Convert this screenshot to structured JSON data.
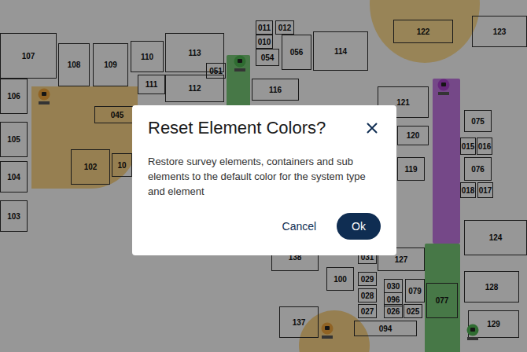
{
  "map": {
    "rooms": [
      {
        "label": "107"
      },
      {
        "label": "108"
      },
      {
        "label": "109"
      },
      {
        "label": "110"
      },
      {
        "label": "113"
      },
      {
        "label": "011"
      },
      {
        "label": "012"
      },
      {
        "label": "010"
      },
      {
        "label": "054"
      },
      {
        "label": "056"
      },
      {
        "label": "114"
      },
      {
        "label": "122"
      },
      {
        "label": "123"
      },
      {
        "label": "106"
      },
      {
        "label": "051"
      },
      {
        "label": "111"
      },
      {
        "label": "112"
      },
      {
        "label": "116"
      },
      {
        "label": "121"
      },
      {
        "label": "045"
      },
      {
        "label": "075"
      },
      {
        "label": "015"
      },
      {
        "label": "016"
      },
      {
        "label": "105"
      },
      {
        "label": "120"
      },
      {
        "label": "076"
      },
      {
        "label": "104"
      },
      {
        "label": "102"
      },
      {
        "label": "10"
      },
      {
        "label": "119"
      },
      {
        "label": "018"
      },
      {
        "label": "017"
      },
      {
        "label": "124"
      },
      {
        "label": "103"
      },
      {
        "label": "138"
      },
      {
        "label": "127"
      },
      {
        "label": "031"
      },
      {
        "label": "029"
      },
      {
        "label": "030"
      },
      {
        "label": "079"
      },
      {
        "label": "100"
      },
      {
        "label": "028"
      },
      {
        "label": "096"
      },
      {
        "label": "128"
      },
      {
        "label": "077"
      },
      {
        "label": "027"
      },
      {
        "label": "026"
      },
      {
        "label": "025"
      },
      {
        "label": "137"
      },
      {
        "label": "094"
      },
      {
        "label": "129"
      }
    ],
    "zones": [
      {
        "color": "#f5cf7a"
      },
      {
        "color": "#f2c66e"
      },
      {
        "color": "#f2c66e"
      },
      {
        "color": "#b35dd6"
      },
      {
        "color": "#5cb85c"
      },
      {
        "color": "#5cb85c"
      }
    ],
    "pins": [
      {
        "color": "#e8a13a"
      },
      {
        "color": "#e8a13a"
      },
      {
        "color": "#4caf50"
      },
      {
        "color": "#4caf50"
      },
      {
        "color": "#a640c8"
      }
    ]
  },
  "dialog": {
    "title": "Reset Element Colors?",
    "body": "Restore survey elements, containers and sub elements to the default color for the system type and element",
    "buttons": [
      {
        "label": "Cancel",
        "primary": false
      },
      {
        "label": "Ok",
        "primary": true
      }
    ]
  }
}
